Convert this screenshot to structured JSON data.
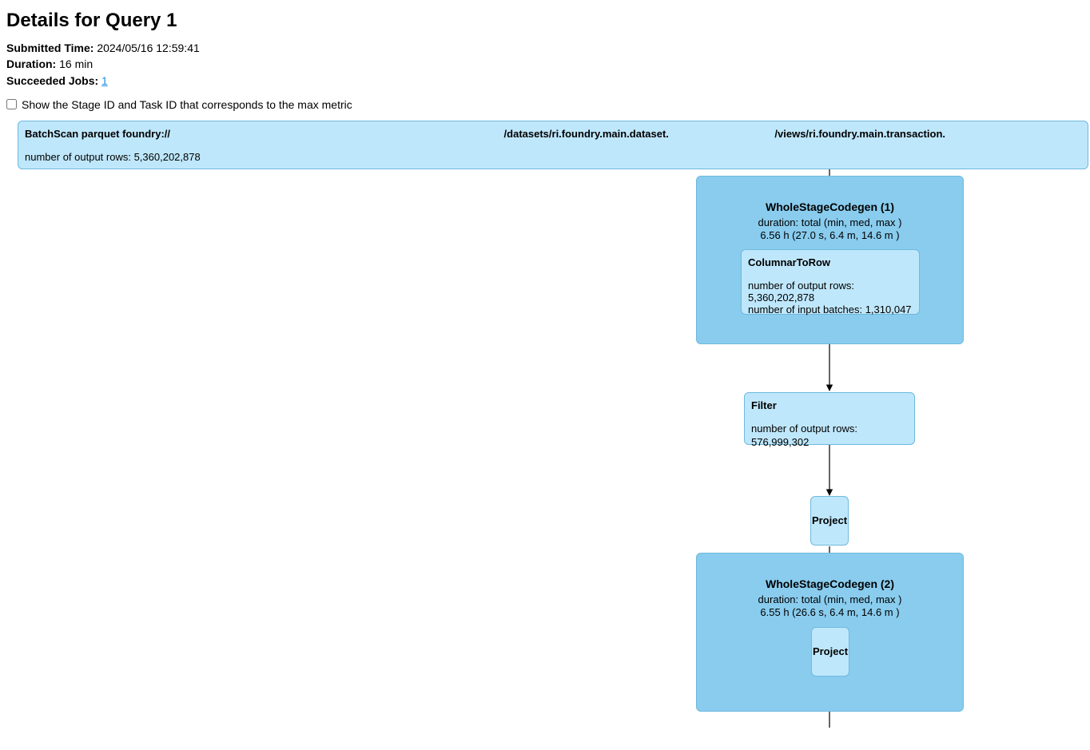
{
  "page": {
    "title": "Details for Query 1"
  },
  "meta": {
    "submitted_label": "Submitted Time:",
    "submitted_value": "2024/05/16 12:59:41",
    "duration_label": "Duration:",
    "duration_value": "16 min",
    "succeeded_label": "Succeeded Jobs:",
    "succeeded_link": "1"
  },
  "checkbox": {
    "label": "Show the Stage ID and Task ID that corresponds to the max metric"
  },
  "batchscan": {
    "seg1": "BatchScan parquet foundry://",
    "seg2": "/datasets/ri.foundry.main.dataset.",
    "seg3": "/views/ri.foundry.main.transaction.",
    "metric": "number of output rows: 5,360,202,878"
  },
  "stage1": {
    "title": "WholeStageCodegen (1)",
    "line1": "duration: total (min, med, max )",
    "line2": "6.56 h (27.0 s, 6.4 m, 14.6 m )"
  },
  "colrow": {
    "title": "ColumnarToRow",
    "m1": "number of output rows: 5,360,202,878",
    "m2": "number of input batches: 1,310,047"
  },
  "filter": {
    "title": "Filter",
    "m1": "number of output rows: 576,999,302"
  },
  "project1": {
    "title": "Project"
  },
  "stage2": {
    "title": "WholeStageCodegen (2)",
    "line1": "duration: total (min, med, max )",
    "line2": "6.55 h (26.6 s, 6.4 m, 14.6 m )"
  },
  "project2": {
    "title": "Project"
  }
}
